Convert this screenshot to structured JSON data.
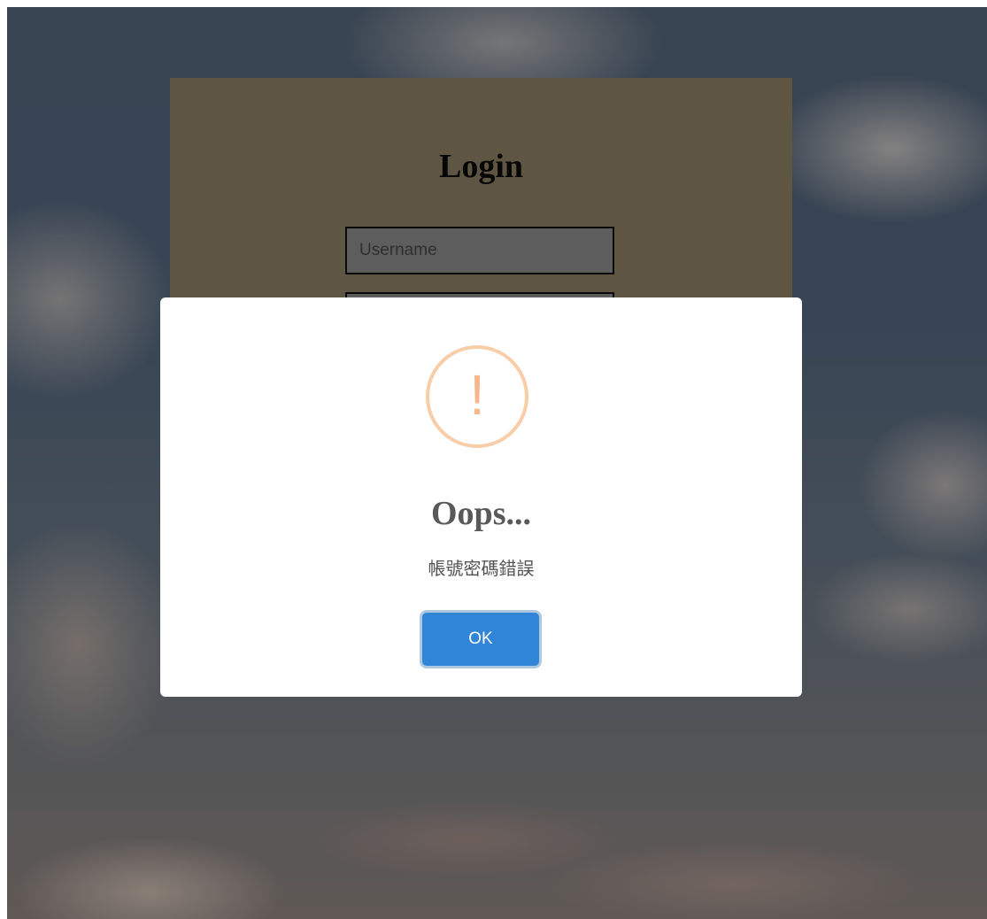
{
  "login": {
    "title": "Login",
    "username_placeholder": "Username",
    "password_placeholder": ""
  },
  "alert": {
    "icon": "warning-exclamation-icon",
    "icon_glyph": "!",
    "title": "Oops...",
    "message": "帳號密碼錯誤",
    "ok_label": "OK"
  },
  "colors": {
    "login_card": "#998a6d",
    "ok_button": "#3085d6",
    "warning_icon": "#f8cda8",
    "popup_background": "#ffffff"
  }
}
